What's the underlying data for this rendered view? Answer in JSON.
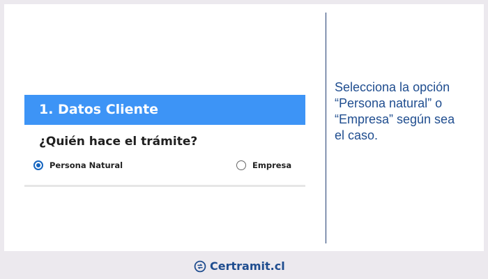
{
  "form": {
    "title": "1. Datos Cliente",
    "question": "¿Quién hace el trámite?",
    "options": [
      {
        "label": "Persona Natural",
        "selected": true
      },
      {
        "label": "Empresa",
        "selected": false
      }
    ]
  },
  "instruction": {
    "lines": [
      "Selecciona la opción",
      "“Persona natural” o",
      "“Empresa” según sea",
      "el caso."
    ]
  },
  "footer": {
    "brand": "Certramit.cl",
    "logo_icon": "certramit-logo-icon"
  },
  "colors": {
    "page_background": "#ece9ee",
    "card_background": "#ffffff",
    "header_blue": "#3d94f6",
    "radio_selected": "#1565c0",
    "navy_text": "#1f4d8f",
    "separator": "#1e3a6f"
  }
}
